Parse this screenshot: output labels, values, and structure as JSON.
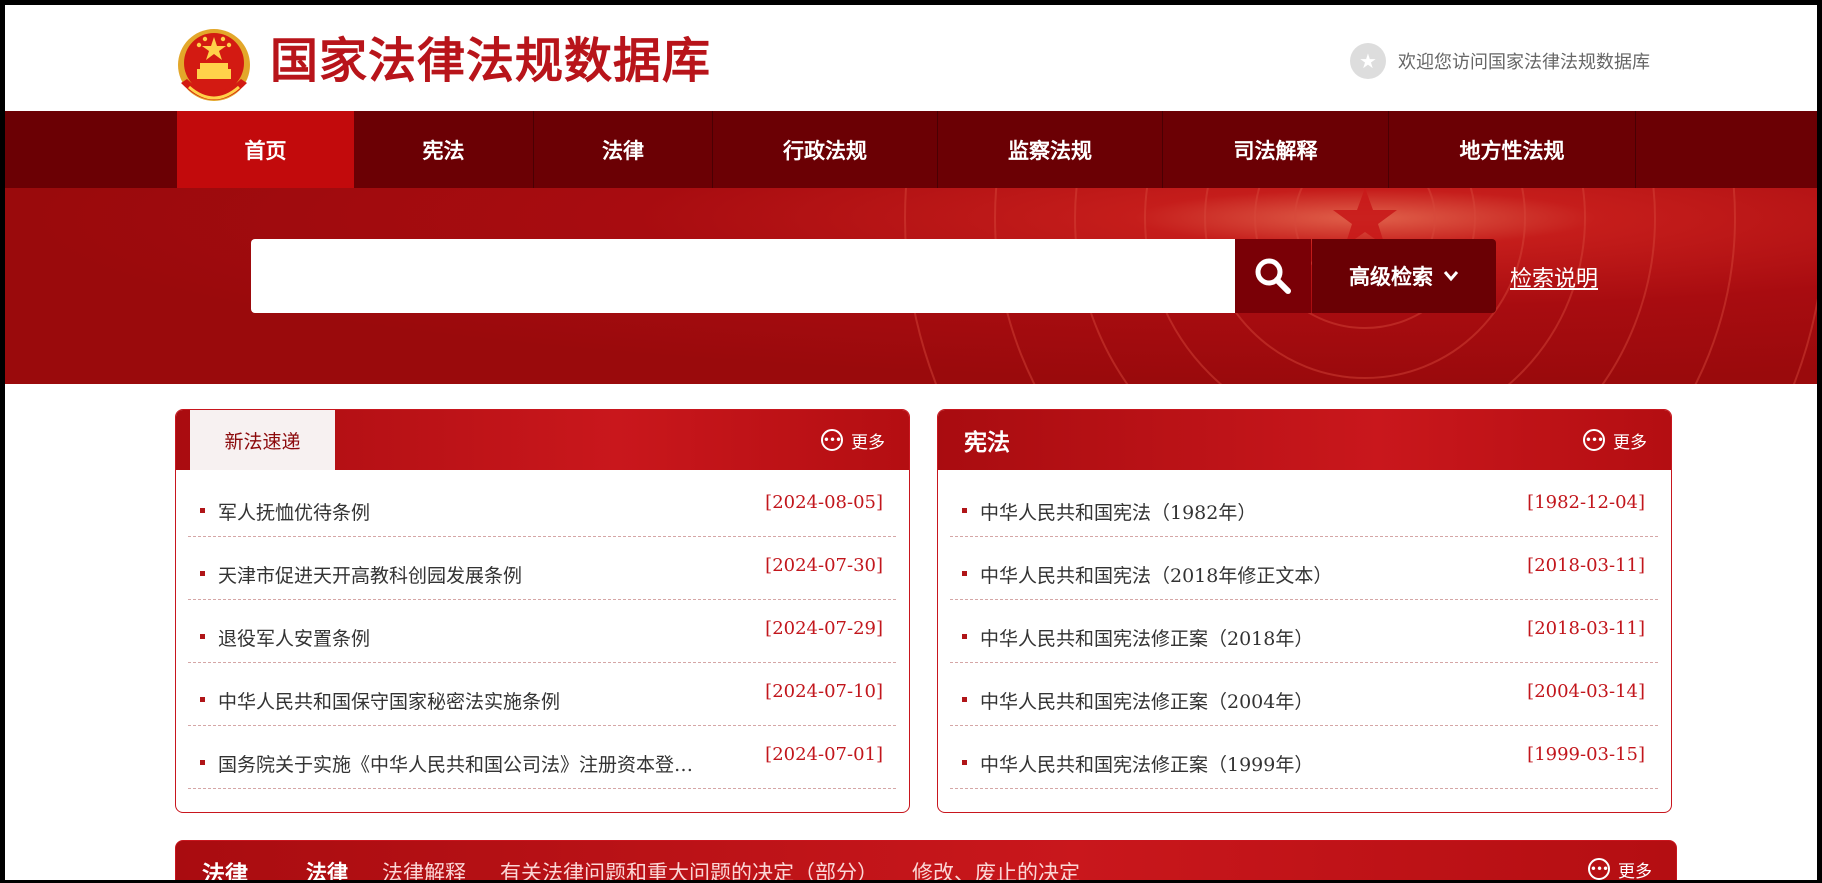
{
  "header": {
    "site_title": "国家法律法规数据库",
    "welcome_text": "欢迎您访问国家法律法规数据库"
  },
  "nav": {
    "items": [
      {
        "label": "首页",
        "active": true
      },
      {
        "label": "宪法"
      },
      {
        "label": "法律"
      },
      {
        "label": "行政法规"
      },
      {
        "label": "监察法规"
      },
      {
        "label": "司法解释"
      },
      {
        "label": "地方性法规"
      }
    ]
  },
  "search": {
    "value": "",
    "advanced_label": "高级检索",
    "help_label": "检索说明"
  },
  "panel_new": {
    "tab_label": "新法速递",
    "more_label": "更多",
    "items": [
      {
        "title": "军人抚恤优待条例",
        "date": "[2024-08-05]"
      },
      {
        "title": "天津市促进天开高教科创园发展条例",
        "date": "[2024-07-30]"
      },
      {
        "title": "退役军人安置条例",
        "date": "[2024-07-29]"
      },
      {
        "title": "中华人民共和国保守国家秘密法实施条例",
        "date": "[2024-07-10]"
      },
      {
        "title": "国务院关于实施《中华人民共和国公司法》注册资本登…",
        "date": "[2024-07-01]"
      }
    ]
  },
  "panel_constitution": {
    "title": "宪法",
    "more_label": "更多",
    "items": [
      {
        "title": "中华人民共和国宪法（1982年）",
        "date": "[1982-12-04]"
      },
      {
        "title": "中华人民共和国宪法（2018年修正文本）",
        "date": "[2018-03-11]"
      },
      {
        "title": "中华人民共和国宪法修正案（2018年）",
        "date": "[2018-03-11]"
      },
      {
        "title": "中华人民共和国宪法修正案（2004年）",
        "date": "[2004-03-14]"
      },
      {
        "title": "中华人民共和国宪法修正案（1999年）",
        "date": "[1999-03-15]"
      }
    ]
  },
  "panel_law": {
    "title": "法律",
    "more_label": "更多",
    "tabs": [
      {
        "label": "法律",
        "active": true
      },
      {
        "label": "法律解释"
      },
      {
        "label": "有关法律问题和重大问题的决定（部分）"
      },
      {
        "label": "修改、废止的决定"
      }
    ]
  },
  "colors": {
    "brand_red": "#b8141a",
    "nav_dark": "#6b0004",
    "nav_active": "#c20a0c",
    "date_red": "#c2161c"
  },
  "icons": {
    "emblem": "national-emblem-icon",
    "welcome": "star-icon",
    "search": "search-icon",
    "advanced": "chevron-down-icon",
    "more": "more-dots-icon"
  }
}
